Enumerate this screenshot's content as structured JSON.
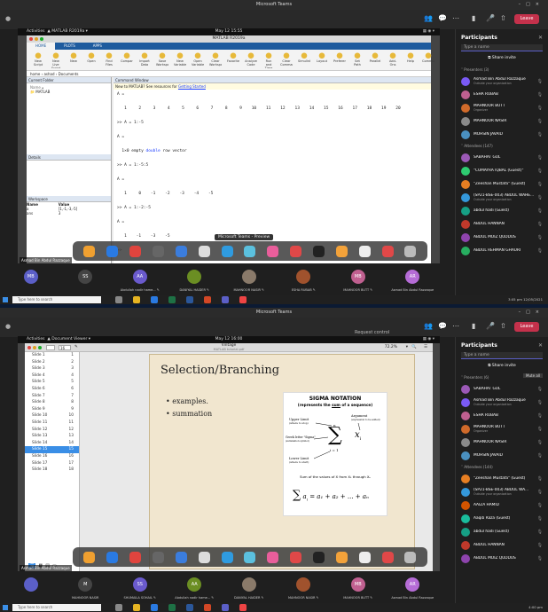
{
  "window_title": "Microsoft Teams",
  "leave_label": "Leave",
  "participants_title": "Participants",
  "search_placeholder": "Type a name",
  "share_invite": "Share invite",
  "panel1": {
    "guest_left": "Activities",
    "guest_app": "MATLAB R2019a",
    "guest_clock": "May 12 15:55",
    "matlab_title": "MATLAB R2019a",
    "ribbon_tabs": [
      "HOME",
      "PLOTS",
      "APPS"
    ],
    "ribbon_groups": [
      "New Script",
      "New Live Script",
      "New",
      "Open",
      "Find Files",
      "Compare",
      "Import Data",
      "Save Workspace",
      "New Variable",
      "Open Variable",
      "Clear Workspace",
      "Favorites",
      "Analyze Code",
      "Run and Time",
      "Clear Commands",
      "Simulink",
      "Layout",
      "Preferences",
      "Set Path",
      "Parallel",
      "Add-Ons",
      "Help",
      "Community",
      "Request Support",
      "Learn MATLAB"
    ],
    "path": "home › ashad › Documents",
    "current_folder": "Current Folder",
    "folder_item": "MATLAB",
    "details": "Details",
    "workspace": "Workspace",
    "ws_headers": [
      "Name",
      "Value"
    ],
    "ws_rows": [
      [
        "a",
        "[1,-1,-3,-5]"
      ],
      [
        "ans",
        "3"
      ]
    ],
    "command_window": "Command Window",
    "notice_prefix": "New to MATLAB? See resources for ",
    "notice_link": "Getting Started",
    "cmd_lines": [
      "A =",
      "",
      "   1     2     3     4     5     6     7     8     9    10    11    12    13    14    15    16    17    18    19    20",
      "",
      ">> A = 1:-5",
      "",
      "A =",
      "",
      "  1×0 empty ",
      "double",
      " row vector",
      "",
      ">> A = 1:-5:5",
      "",
      "A =",
      "",
      "   1     0    -1    -2    -3    -4    -5",
      "",
      ">> A = 1:-2:-5",
      "",
      "A =",
      "",
      "   1    -1    -3    -5",
      "",
      ">> "
    ],
    "dock_tooltip": "Microsoft Teams - Preview",
    "presenter_label": "Asmad Bin Abdul Razzaque",
    "tiles": [
      {
        "initials": "MB",
        "name": ""
      },
      {
        "initials": "SS",
        "name": ""
      },
      {
        "initials": "AA",
        "name": "Abdullah nadir hame... ✎"
      },
      {
        "initials": "",
        "name": "DANIYAL HAIDER ✎"
      },
      {
        "initials": "",
        "name": "MAHNOOR NASIR ✎"
      },
      {
        "initials": "",
        "name": "ESHA RUBAB ✎"
      },
      {
        "initials": "MB",
        "name": "MAHNOOR BUTT ✎"
      },
      {
        "initials": "AR",
        "name": "Asmad Bin Abdul Razzaque"
      }
    ],
    "presenters_label": "Presenters (3)",
    "presenters": [
      {
        "name": "Asmad Bin Abdul Razzaque",
        "sub": "Outside your organization",
        "color": "#7a5af5"
      },
      {
        "name": "ESHA RUBAB",
        "sub": "",
        "color": "#c06090"
      },
      {
        "name": "MAHNOOR BUTT",
        "sub": "Organizer",
        "color": "#d06a2a"
      },
      {
        "name": "MAHNOOR NASIR",
        "sub": "",
        "color": "#8a8a8a"
      },
      {
        "name": "MOHSIN JAVAID",
        "sub": "",
        "color": "#4a90c0"
      }
    ],
    "attendees_label": "Attendees (147)",
    "attendees": [
      {
        "name": "SABAHAT GUL",
        "color": "#9b59b6"
      },
      {
        "name": "\"CUMAYRA IQBAL (Guest)\"",
        "color": "#2ecc71"
      },
      {
        "name": "\"Zeeshan Mustafa\" (Guest)",
        "color": "#e67e22"
      },
      {
        "name": "(SP21-BSE-003) ABDUL WAHE...",
        "sub": "Outside your organization",
        "color": "#3498db"
      },
      {
        "name": "abdul hadi (Guest)",
        "color": "#16a085"
      },
      {
        "name": "ABDUL HANNAN",
        "color": "#c0392b"
      },
      {
        "name": "ABDUL MOIZ QUDDUS",
        "color": "#8e44ad"
      },
      {
        "name": "ABDUL REHMAN GHAURI",
        "color": "#27ae60"
      }
    ],
    "taskbar_search": "Type here to search",
    "taskbar_time": "3:05 pm 12/05/2021"
  },
  "panel2": {
    "guest_left": "Activities",
    "guest_app": "Document Viewer",
    "guest_clock": "May 12 16:00",
    "dv_title": "Vintage",
    "dv_sub": "MATLAB tutorial.pdf",
    "page_field": "16",
    "zoom": "72.2%",
    "slides": [
      [
        "Slide 1",
        "1"
      ],
      [
        "Slide 2",
        "2"
      ],
      [
        "Slide 3",
        "3"
      ],
      [
        "Slide 4",
        "4"
      ],
      [
        "Slide 5",
        "5"
      ],
      [
        "Slide 6",
        "6"
      ],
      [
        "Slide 7",
        "7"
      ],
      [
        "Slide 8",
        "8"
      ],
      [
        "Slide 9",
        "9"
      ],
      [
        "Slide 10",
        "10"
      ],
      [
        "Slide 11",
        "11"
      ],
      [
        "Slide 12",
        "12"
      ],
      [
        "Slide 13",
        "13"
      ],
      [
        "Slide 14",
        "14"
      ],
      [
        "Slide 15",
        "15"
      ],
      [
        "Slide 16",
        "16"
      ],
      [
        "Slide 17",
        "17"
      ],
      [
        "Slide 18",
        "18"
      ]
    ],
    "selected_slide": "15",
    "slide_title": "Selection/Branching",
    "bullets": [
      "examples.",
      "summation"
    ],
    "sigma_title": "SIGMA NOTATION",
    "sigma_sub_pre": "(represents the ",
    "sigma_sub_u": "sum",
    "sigma_sub_post": " of a sequence)",
    "lbl_upper": "Upper Limit",
    "lbl_upper_sub": "(where to stop)",
    "lbl_argument": "Argument",
    "lbl_argument_sub": "(expression to be added)",
    "lbl_greek": "Greek letter \"Sigma\"",
    "lbl_greek_sub": "(summation symbol)",
    "lbl_lower": "Lower Limit",
    "lbl_lower_sub": "(where to start)",
    "sum_n": "n",
    "sum_i": "i = 1",
    "sum_body": "x",
    "sum_desc": "Sum of the values of X from X₁ through Xₙ",
    "formula": "a₁ + a₂ + ... + aₙ",
    "request_control": "Request control",
    "presenter_label": "Asmad Bin Abdul Razzaque",
    "tiles": [
      {
        "initials": "",
        "name": ""
      },
      {
        "initials": "M",
        "name": "MAHNOOR NASIR"
      },
      {
        "initials": "SS",
        "name": "SHUMAILA SOHAIL ✎"
      },
      {
        "initials": "AA",
        "name": "Abdullah nadir hame... ✎"
      },
      {
        "initials": "",
        "name": "DANIYAL HAIDER ✎"
      },
      {
        "initials": "",
        "name": "MAHNOOR NASIR ✎"
      },
      {
        "initials": "MB",
        "name": "MAHNOOR BUTT ✎"
      },
      {
        "initials": "AR",
        "name": "Asmad Bin Abdul Razzaque"
      }
    ],
    "presenters_label": "Presenters (6)",
    "mute_all": "Mute all",
    "presenters": [
      {
        "name": "SABAHAT GUL",
        "sub": "",
        "color": "#9b59b6"
      },
      {
        "name": "Asmad Bin Abdul Razzaque",
        "sub": "Outside your organization",
        "color": "#7a5af5"
      },
      {
        "name": "ESHA RUBAB",
        "sub": "",
        "color": "#c06090"
      },
      {
        "name": "MAHNOOR BUTT",
        "sub": "Organizer",
        "color": "#d06a2a"
      },
      {
        "name": "MAHNOOR NASIR",
        "sub": "",
        "color": "#8a8a8a"
      },
      {
        "name": "MOHSIN JAVAID",
        "sub": "",
        "color": "#4a90c0"
      }
    ],
    "attendees_label": "Attendees (144)",
    "attendees": [
      {
        "name": "\"Zeeshan Mustafa\" (Guest)",
        "color": "#e67e22"
      },
      {
        "name": "(SP21-BSE-003) ABDUL WA...",
        "sub": "Outside your organization",
        "color": "#3498db"
      },
      {
        "name": "AAIZA HAMID",
        "color": "#d35400"
      },
      {
        "name": "Aaqib Raza (Guest)",
        "color": "#1abc9c"
      },
      {
        "name": "abdul hadi (Guest)",
        "color": "#16a085"
      },
      {
        "name": "ABDUL HANNAN",
        "color": "#c0392b"
      },
      {
        "name": "ABDUL MOIZ QUDDUS",
        "color": "#8e44ad"
      }
    ],
    "taskbar_search": "Type here to search",
    "taskbar_time": "4:00 pm"
  }
}
